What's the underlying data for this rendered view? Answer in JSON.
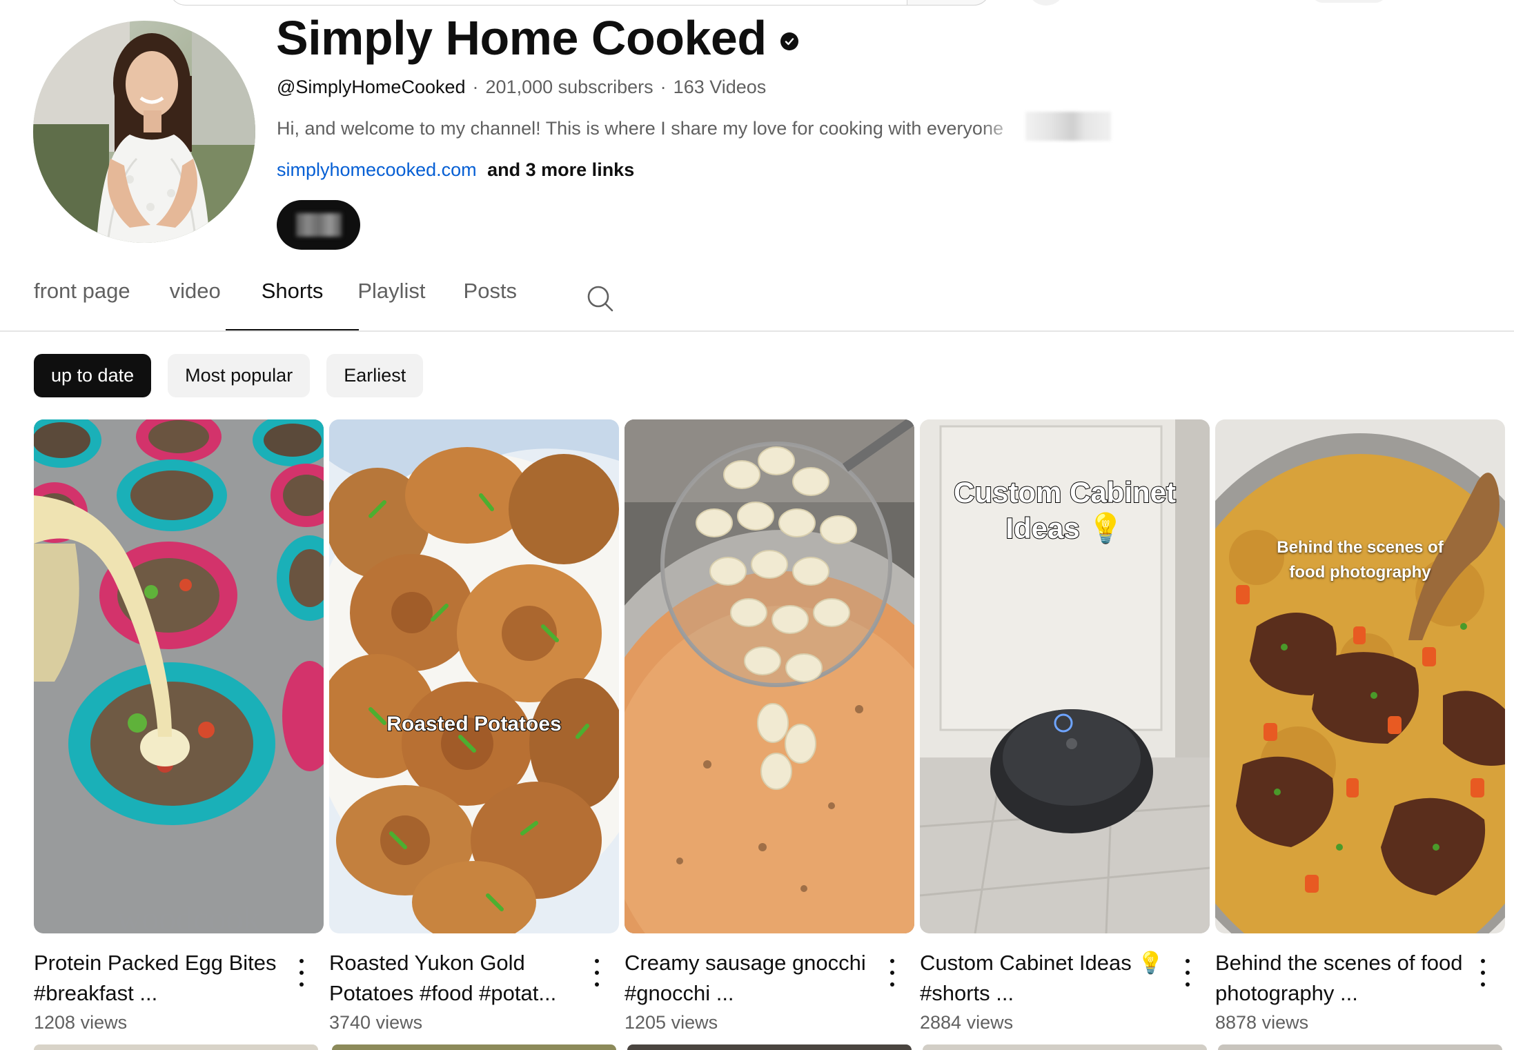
{
  "channel": {
    "name": "Simply Home Cooked",
    "handle": "@SimplyHomeCooked",
    "subscribers": "201,000 subscribers",
    "videos": "163 Videos",
    "separator": "·",
    "description": "Hi, and welcome to my channel! This is where I share my love for cooking with everyone",
    "link": "simplyhomecooked.com",
    "more_links": "and 3 more links"
  },
  "tabs": [
    {
      "label": "front page"
    },
    {
      "label": "video"
    },
    {
      "label": "Shorts"
    },
    {
      "label": "Playlist"
    },
    {
      "label": "Posts"
    }
  ],
  "chips": [
    {
      "label": "up to date"
    },
    {
      "label": "Most popular"
    },
    {
      "label": "Earliest"
    }
  ],
  "shorts": [
    {
      "title": "Protein Packed Egg Bites #breakfast ...",
      "views": "1208 views",
      "overlay": ""
    },
    {
      "title": "Roasted Yukon Gold Potatoes #food #potat...",
      "views": "3740 views",
      "overlay": "Roasted Potatoes"
    },
    {
      "title": "Creamy sausage gnocchi #gnocchi ...",
      "views": "1205 views",
      "overlay": ""
    },
    {
      "title": "Custom Cabinet Ideas 💡 #shorts ...",
      "views": "2884 views",
      "overlay_line1": "Custom Cabinet",
      "overlay_line2": "Ideas 💡"
    },
    {
      "title": "Behind the scenes of food photography ...",
      "views": "8878 views",
      "overlay_line1": "Behind the scenes of",
      "overlay_line2": "food photography"
    }
  ],
  "icons": {
    "verified": "verified-check-icon",
    "search": "search-icon",
    "more": "more-vert-icon"
  },
  "colors": {
    "link": "#065fd4",
    "active_chip": "#0f0f0f",
    "chip": "#f2f2f2",
    "secondary_text": "#606060"
  }
}
